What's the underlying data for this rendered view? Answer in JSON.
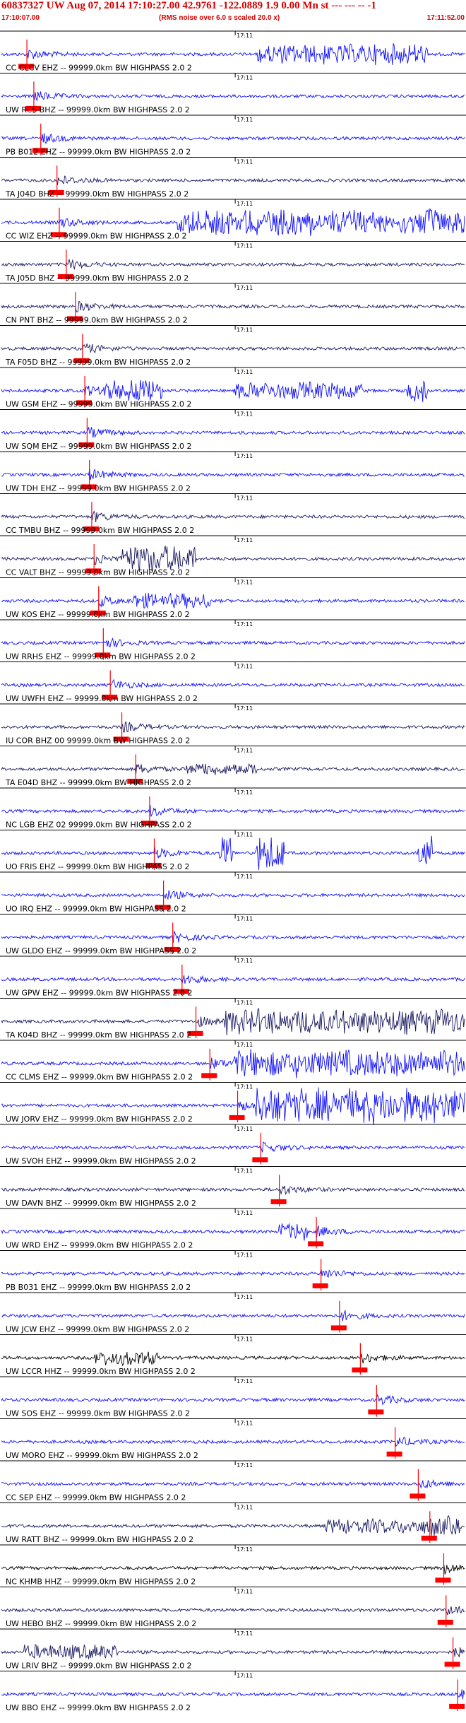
{
  "header": {
    "title": "60837327 UW Aug 07, 2014 17:10:27.00   42.9761 -122.0889  1.9 0.00 Mn st --- --- -- -1",
    "start_time": "17:10:07.00",
    "note": "(RMS noise over 6.0 s scaled 20.0 x)",
    "end_time": "17:11:52.00"
  },
  "colors": {
    "blue": "#1010ff",
    "navy": "#181860",
    "black": "#000000",
    "pick": "#ff0000",
    "grid": "#000000"
  },
  "chart_data": {
    "type": "line",
    "description_source": "seismogram record section",
    "x_time_range": [
      "17:10:07.00",
      "17:11:52.00"
    ],
    "minute_tick_label": "17:11",
    "traces": [
      {
        "label": "CC CLCV EHZ -- 99999.0km BW  HIGHPASS  2.0  2",
        "color": "blue"
      },
      {
        "label": "UW RCS BHZ -- 99999.0km BW  HIGHPASS  2.0  2",
        "color": "blue"
      },
      {
        "label": "PB B012 EHZ -- 99999.0km BW  HIGHPASS  2.0  2",
        "color": "blue"
      },
      {
        "label": "TA J04D BHZ -- 99999.0km BW  HIGHPASS  2.0  2",
        "color": "navy"
      },
      {
        "label": "CC WIZ EHZ -- 99999.0km BW  HIGHPASS  2.0  2",
        "color": "blue"
      },
      {
        "label": "TA J05D BHZ -- 99999.0km BW  HIGHPASS  2.0  2",
        "color": "navy"
      },
      {
        "label": "CN PNT BHZ -- 99999.0km BW  HIGHPASS  2.0  2",
        "color": "navy"
      },
      {
        "label": "TA F05D BHZ -- 99999.0km BW  HIGHPASS  2.0  2",
        "color": "navy"
      },
      {
        "label": "UW GSM EHZ -- 99999.0km BW  HIGHPASS  2.0  2",
        "color": "blue"
      },
      {
        "label": "UW SQM EHZ -- 99999.0km BW  HIGHPASS  2.0  2",
        "color": "blue"
      },
      {
        "label": "UW TDH EHZ -- 99999.0km BW  HIGHPASS  2.0  2",
        "color": "blue"
      },
      {
        "label": "CC TMBU BHZ -- 99999.0km BW  HIGHPASS  2.0  2",
        "color": "navy"
      },
      {
        "label": "CC VALT BHZ -- 99999.0km BW  HIGHPASS  2.0  2",
        "color": "navy"
      },
      {
        "label": "UW KOS EHZ -- 99999.0km BW  HIGHPASS  2.0  2",
        "color": "blue"
      },
      {
        "label": "UW RRHS EHZ -- 99999.0km BW  HIGHPASS  2.0  2",
        "color": "blue"
      },
      {
        "label": "UW UWFH EHZ -- 99999.0km BW  HIGHPASS  2.0  2",
        "color": "blue"
      },
      {
        "label": "IU COR BHZ 00 99999.0km BW  HIGHPASS  2.0  2",
        "color": "navy"
      },
      {
        "label": "TA E04D BHZ -- 99999.0km BW  HIGHPASS  2.0  2",
        "color": "navy"
      },
      {
        "label": "NC LGB EHZ 02 99999.0km BW  HIGHPASS  2.0  2",
        "color": "blue"
      },
      {
        "label": "UO FRIS EHZ -- 99999.0km BW  HIGHPASS  2.0  2",
        "color": "blue"
      },
      {
        "label": "UO IRQ EHZ -- 99999.0km BW  HIGHPASS  2.0  2",
        "color": "blue"
      },
      {
        "label": "UW GLDO EHZ -- 99999.0km BW  HIGHPASS  2.0  2",
        "color": "blue"
      },
      {
        "label": "UW GPW EHZ -- 99999.0km BW  HIGHPASS  2.0  2",
        "color": "blue"
      },
      {
        "label": "TA K04D BHZ -- 99999.0km BW  HIGHPASS  2.0  2",
        "color": "navy"
      },
      {
        "label": "CC CLMS EHZ -- 99999.0km BW  HIGHPASS  2.0  2",
        "color": "blue"
      },
      {
        "label": "UW JORV EHZ -- 99999.0km BW  HIGHPASS  2.0  2",
        "color": "blue"
      },
      {
        "label": "UW SVOH EHZ -- 99999.0km BW  HIGHPASS  2.0  2",
        "color": "blue"
      },
      {
        "label": "UW DAVN BHZ -- 99999.0km BW  HIGHPASS  2.0  2",
        "color": "navy"
      },
      {
        "label": "UW WRD EHZ -- 99999.0km BW  HIGHPASS  2.0  2",
        "color": "blue"
      },
      {
        "label": "PB B031 EHZ -- 99999.0km BW  HIGHPASS  2.0  2",
        "color": "blue"
      },
      {
        "label": "UW JCW EHZ -- 99999.0km BW  HIGHPASS  2.0  2",
        "color": "blue"
      },
      {
        "label": "UW LCCR HHZ -- 99999.0km BW  HIGHPASS  2.0  2",
        "color": "black"
      },
      {
        "label": "UW SOS EHZ -- 99999.0km BW  HIGHPASS  2.0  2",
        "color": "blue"
      },
      {
        "label": "UW MORO EHZ -- 99999.0km BW  HIGHPASS  2.0  2",
        "color": "blue"
      },
      {
        "label": "CC SEP EHZ -- 99999.0km BW  HIGHPASS  2.0  2",
        "color": "blue"
      },
      {
        "label": "UW RATT BHZ -- 99999.0km BW  HIGHPASS  2.0  2",
        "color": "navy"
      },
      {
        "label": "NC KHMB HHZ -- 99999.0km BW  HIGHPASS  2.0  2",
        "color": "black"
      },
      {
        "label": "UW HEBO BHZ -- 99999.0km BW  HIGHPASS  2.0  2",
        "color": "navy"
      },
      {
        "label": "UW LRIV BHZ -- 99999.0km BW  HIGHPASS  2.0  2",
        "color": "navy"
      },
      {
        "label": "UW BBO EHZ -- 99999.0km BW  HIGHPASS  2.0  2",
        "color": "blue"
      }
    ]
  }
}
